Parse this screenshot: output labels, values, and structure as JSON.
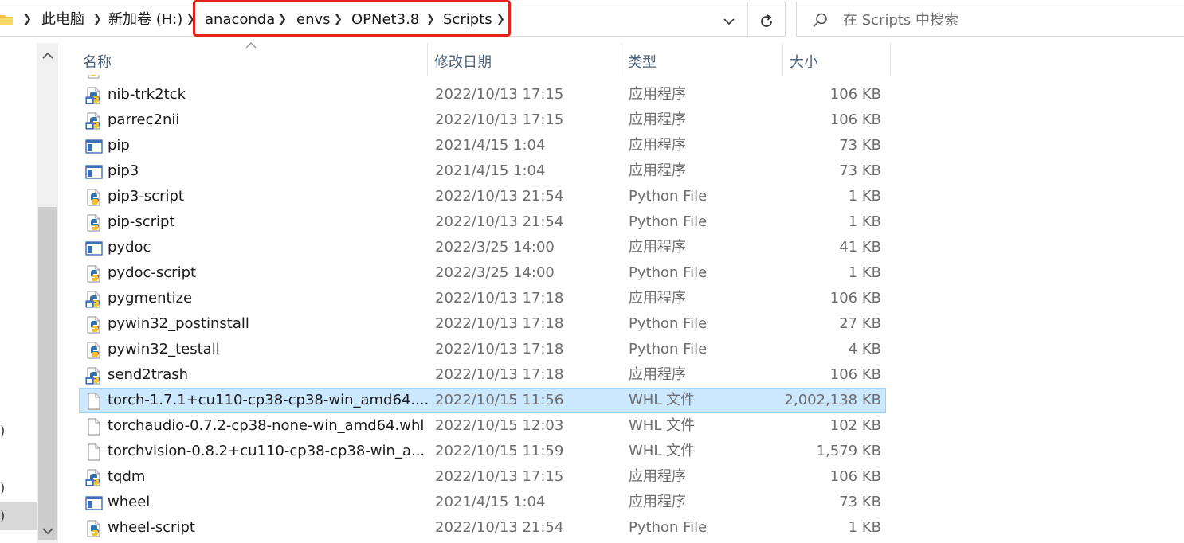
{
  "breadcrumb": {
    "items": [
      "此电脑",
      "新加卷 (H:)",
      "anaconda",
      "envs",
      "OPNet3.8",
      "Scripts"
    ]
  },
  "search": {
    "placeholder": "在 Scripts 中搜索"
  },
  "columns": {
    "name": "名称",
    "date": "修改日期",
    "type": "类型",
    "size": "大小"
  },
  "left_stub": [
    ")",
    ")",
    ")"
  ],
  "files": [
    {
      "name": "nib-trk2tck",
      "date": "2022/10/13 17:15",
      "type": "应用程序",
      "size": "106 KB",
      "icon": "python-exe-icon"
    },
    {
      "name": "parrec2nii",
      "date": "2022/10/13 17:15",
      "type": "应用程序",
      "size": "106 KB",
      "icon": "python-exe-icon"
    },
    {
      "name": "pip",
      "date": "2021/4/15 1:04",
      "type": "应用程序",
      "size": "73 KB",
      "icon": "app-window-icon"
    },
    {
      "name": "pip3",
      "date": "2021/4/15 1:04",
      "type": "应用程序",
      "size": "73 KB",
      "icon": "app-window-icon"
    },
    {
      "name": "pip3-script",
      "date": "2022/10/13 21:54",
      "type": "Python File",
      "size": "1 KB",
      "icon": "python-file-icon"
    },
    {
      "name": "pip-script",
      "date": "2022/10/13 21:54",
      "type": "Python File",
      "size": "1 KB",
      "icon": "python-file-icon"
    },
    {
      "name": "pydoc",
      "date": "2022/3/25 14:00",
      "type": "应用程序",
      "size": "41 KB",
      "icon": "app-window-icon"
    },
    {
      "name": "pydoc-script",
      "date": "2022/3/25 14:00",
      "type": "Python File",
      "size": "1 KB",
      "icon": "python-file-icon"
    },
    {
      "name": "pygmentize",
      "date": "2022/10/13 17:18",
      "type": "应用程序",
      "size": "106 KB",
      "icon": "python-exe-icon"
    },
    {
      "name": "pywin32_postinstall",
      "date": "2022/10/13 17:18",
      "type": "Python File",
      "size": "27 KB",
      "icon": "python-file-icon"
    },
    {
      "name": "pywin32_testall",
      "date": "2022/10/13 17:18",
      "type": "Python File",
      "size": "4 KB",
      "icon": "python-file-icon"
    },
    {
      "name": "send2trash",
      "date": "2022/10/13 17:18",
      "type": "应用程序",
      "size": "106 KB",
      "icon": "python-exe-icon"
    },
    {
      "name": "torch-1.7.1+cu110-cp38-cp38-win_amd64....",
      "date": "2022/10/15 11:56",
      "type": "WHL 文件",
      "size": "2,002,138 KB",
      "icon": "blank-file-icon",
      "selected": true
    },
    {
      "name": "torchaudio-0.7.2-cp38-none-win_amd64.whl",
      "date": "2022/10/15 12:03",
      "type": "WHL 文件",
      "size": "102 KB",
      "icon": "blank-file-icon"
    },
    {
      "name": "torchvision-0.8.2+cu110-cp38-cp38-win_a...",
      "date": "2022/10/15 11:59",
      "type": "WHL 文件",
      "size": "1,579 KB",
      "icon": "blank-file-icon"
    },
    {
      "name": "tqdm",
      "date": "2022/10/13 17:15",
      "type": "应用程序",
      "size": "106 KB",
      "icon": "python-exe-icon"
    },
    {
      "name": "wheel",
      "date": "2021/4/15 1:04",
      "type": "应用程序",
      "size": "73 KB",
      "icon": "app-window-icon"
    },
    {
      "name": "wheel-script",
      "date": "2022/10/13 21:54",
      "type": "Python File",
      "size": "1 KB",
      "icon": "python-file-icon"
    }
  ],
  "colors": {
    "selection_bg": "#cce8ff",
    "selection_border": "#99d1ff",
    "highlight_box": "#e8211d",
    "header_text": "#4c607a"
  }
}
